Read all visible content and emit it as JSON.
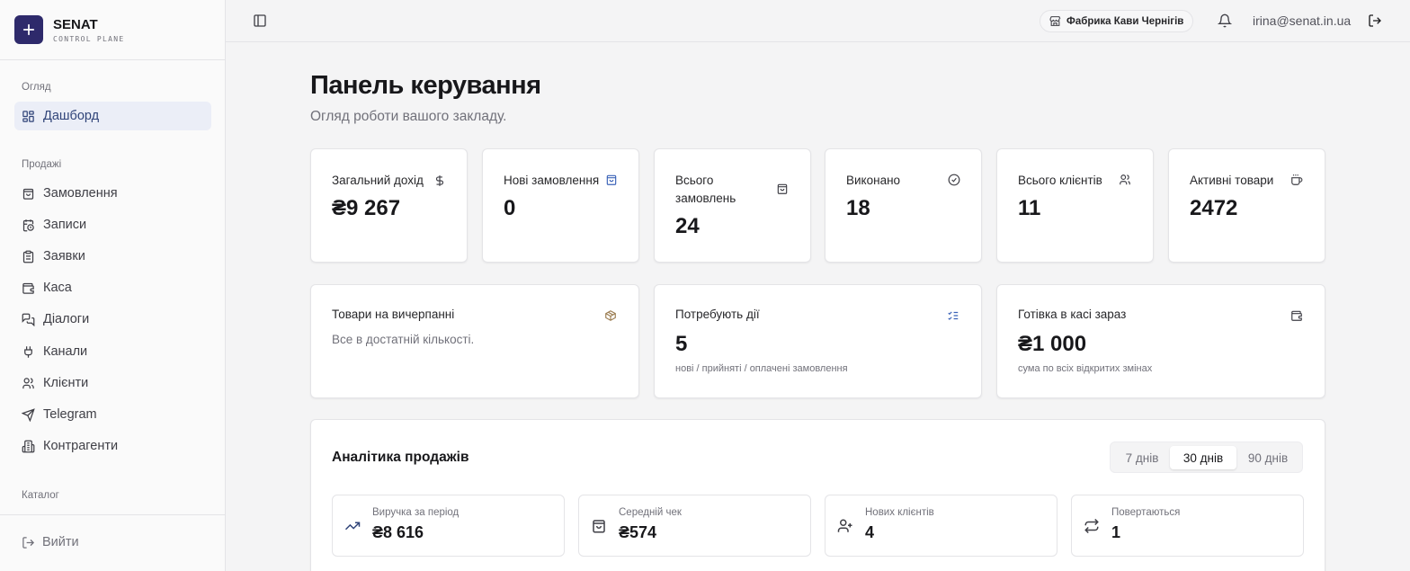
{
  "brand": {
    "name": "SENAT",
    "subtitle": "CONTROL PLANE"
  },
  "sidebar": {
    "sections": [
      {
        "title": "Огляд"
      },
      {
        "title": "Продажі"
      },
      {
        "title": "Каталог"
      }
    ],
    "items": [
      {
        "label": "Дашборд",
        "icon": "grid-icon",
        "active": true
      },
      {
        "label": "Замовлення",
        "icon": "bag-icon"
      },
      {
        "label": "Записи",
        "icon": "calendar-clock-icon"
      },
      {
        "label": "Заявки",
        "icon": "clipboard-icon"
      },
      {
        "label": "Каса",
        "icon": "wallet-icon"
      },
      {
        "label": "Діалоги",
        "icon": "chat-icon"
      },
      {
        "label": "Канали",
        "icon": "plug-icon"
      },
      {
        "label": "Клієнти",
        "icon": "users-icon"
      },
      {
        "label": "Telegram",
        "icon": "send-icon"
      },
      {
        "label": "Контрагенти",
        "icon": "building-icon"
      }
    ],
    "logout_label": "Вийти"
  },
  "topbar": {
    "store_name": "Фабрика Кави Чернігів",
    "user_email": "irina@senat.in.ua"
  },
  "page": {
    "title": "Панель керування",
    "subtitle": "Огляд роботи вашого закладу."
  },
  "stats": [
    {
      "label": "Загальний дохід",
      "value": "₴9 267",
      "icon": "dollar-icon"
    },
    {
      "label": "Нові замовлення",
      "value": "0",
      "icon": "bag-icon"
    },
    {
      "label": "Всього замовлень",
      "value": "24",
      "icon": "bag-icon"
    },
    {
      "label": "Виконано",
      "value": "18",
      "icon": "check-circle-icon"
    },
    {
      "label": "Всього клієнтів",
      "value": "11",
      "icon": "users-icon"
    },
    {
      "label": "Активні товари",
      "value": "2472",
      "icon": "coffee-icon"
    }
  ],
  "info_cards": {
    "low_stock": {
      "label": "Товари на вичерпанні",
      "desc": "Все в достатній кількості.",
      "icon": "package-icon"
    },
    "needs_action": {
      "label": "Потребують дії",
      "value": "5",
      "note": "нові / прийняті / оплачені замовлення",
      "icon": "list-checks-icon"
    },
    "cash_now": {
      "label": "Готівка в касі зараз",
      "value": "₴1 000",
      "note": "сума по всіх відкритих змінах",
      "icon": "wallet-icon"
    }
  },
  "analytics": {
    "title": "Аналітика продажів",
    "periods": [
      "7 днів",
      "30 днів",
      "90 днів"
    ],
    "selected_period": "30 днів",
    "kpis": [
      {
        "label": "Виручка за період",
        "value": "₴8 616",
        "icon": "trending-up-icon"
      },
      {
        "label": "Середній чек",
        "value": "₴574",
        "icon": "bag-icon"
      },
      {
        "label": "Нових клієнтів",
        "value": "4",
        "icon": "user-plus-icon"
      },
      {
        "label": "Повертаються",
        "value": "1",
        "icon": "repeat-icon"
      }
    ]
  },
  "colors": {
    "brand": "#2e2a6b",
    "accent": "#304479",
    "active_bg": "#ebeef7"
  }
}
